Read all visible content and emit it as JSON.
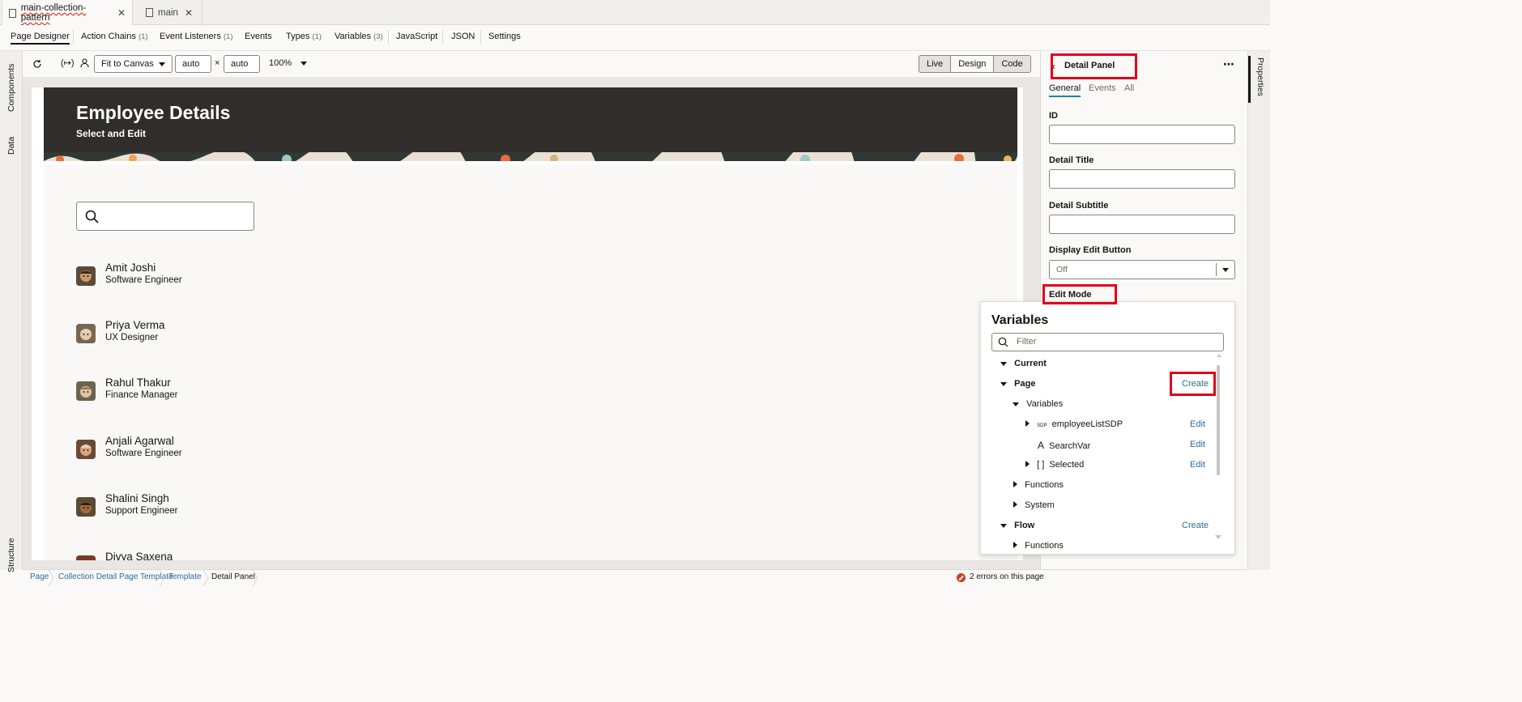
{
  "file_tabs": [
    {
      "label": "main-collection-pattern",
      "active": true
    },
    {
      "label": "main",
      "active": false
    }
  ],
  "menu": {
    "items": [
      {
        "label": "Page Designer",
        "count": ""
      },
      {
        "label": "Action Chains",
        "count": "(1)"
      },
      {
        "label": "Event Listeners",
        "count": "(1)"
      },
      {
        "label": "Events",
        "count": ""
      },
      {
        "label": "Types",
        "count": "(1)"
      },
      {
        "label": "Variables",
        "count": "(3)"
      },
      {
        "label": "JavaScript",
        "count": ""
      },
      {
        "label": "JSON",
        "count": ""
      },
      {
        "label": "Settings",
        "count": ""
      }
    ]
  },
  "left_rail": {
    "components": "Components",
    "data": "Data",
    "structure": "Structure"
  },
  "toolbar": {
    "fit_select": "Fit to Canvas",
    "width_value": "auto",
    "times": "×",
    "height_value": "auto",
    "zoom": "100%",
    "modes": [
      "Live",
      "Design",
      "Code"
    ]
  },
  "page": {
    "title": "Employee Details",
    "subtitle": "Select and Edit",
    "employees": [
      {
        "name": "Amit Joshi",
        "role": "Software Engineer"
      },
      {
        "name": "Priya Verma",
        "role": "UX Designer"
      },
      {
        "name": "Rahul Thakur",
        "role": "Finance Manager"
      },
      {
        "name": "Anjali Agarwal",
        "role": "Software Engineer"
      },
      {
        "name": "Shalini Singh",
        "role": "Support Engineer"
      },
      {
        "name": "Divya Saxena",
        "role": ""
      }
    ]
  },
  "properties": {
    "title": "Detail Panel",
    "more": "⋯",
    "tabs": [
      "General",
      "Events",
      "All"
    ],
    "fields": {
      "id": "ID",
      "detail_title": "Detail Title",
      "detail_subtitle": "Detail Subtitle",
      "display_edit_button": "Display Edit Button",
      "display_edit_value": "Off",
      "edit_mode": "Edit Mode"
    },
    "rail_label": "Properties"
  },
  "variables_popup": {
    "title": "Variables",
    "filter_placeholder": "Filter",
    "current": "Current",
    "page": "Page",
    "create": "Create",
    "variables_group": "Variables",
    "items": [
      {
        "prefix": "SDP",
        "name": "employeeListSDP",
        "action": "Edit"
      },
      {
        "prefix": "A",
        "name": "SearchVar",
        "action": "Edit"
      },
      {
        "prefix": "[ ]",
        "name": "Selected",
        "action": "Edit"
      }
    ],
    "functions": "Functions",
    "system": "System",
    "flow": "Flow",
    "flow_create": "Create",
    "flow_child": "Functions"
  },
  "statusbar": {
    "crumbs": [
      "Page",
      "Collection Detail Page Template",
      "Template",
      "Detail Panel"
    ],
    "errors": "2 errors on this page"
  }
}
